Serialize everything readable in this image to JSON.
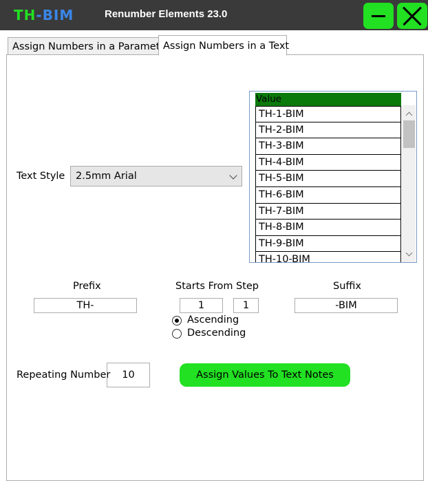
{
  "window": {
    "logo_th": "TH",
    "logo_bim": "-BIM",
    "title": "Renumber Elements 23.0"
  },
  "tabs": [
    {
      "label": "Assign Numbers in a Parameter"
    },
    {
      "label": "Assign Numbers in a Text"
    }
  ],
  "text_style": {
    "label": "Text Style",
    "selected": "2.5mm Arial"
  },
  "values_grid": {
    "header": "Value",
    "rows": [
      "TH-1-BIM",
      "TH-2-BIM",
      "TH-3-BIM",
      "TH-4-BIM",
      "TH-5-BIM",
      "TH-6-BIM",
      "TH-7-BIM",
      "TH-8-BIM",
      "TH-9-BIM",
      "TH-10-BIM"
    ]
  },
  "prefix": {
    "label": "Prefix",
    "value": "TH-"
  },
  "starts_from": {
    "label": "Starts From",
    "value": "1"
  },
  "step": {
    "label": "Step",
    "value": "1"
  },
  "suffix": {
    "label": "Suffix",
    "value": "-BIM"
  },
  "order": {
    "ascending": "Ascending",
    "descending": "Descending",
    "selected": "ascending"
  },
  "repeating": {
    "label": "Repeating Number",
    "value": "10"
  },
  "assign_button": "Assign Values To Text Notes",
  "colors": {
    "accent_green": "#22e022",
    "header_green": "#0a7a0a",
    "titlebar": "#3a3a3a",
    "logo_blue": "#3a86e8"
  }
}
